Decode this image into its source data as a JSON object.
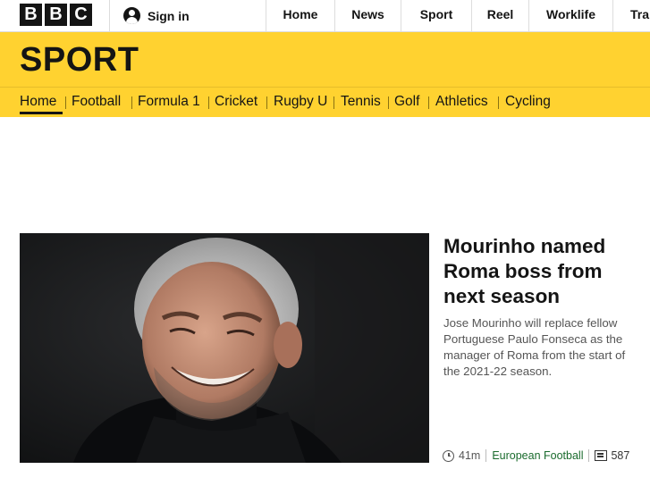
{
  "brand": {
    "letters": [
      "B",
      "B",
      "C"
    ]
  },
  "account": {
    "signin_label": "Sign in"
  },
  "topnav": [
    {
      "label": "Home"
    },
    {
      "label": "News"
    },
    {
      "label": "Sport"
    },
    {
      "label": "Reel"
    },
    {
      "label": "Worklife"
    },
    {
      "label": "Tra"
    }
  ],
  "section": {
    "title": "SPORT"
  },
  "subnav": [
    {
      "label": "Home",
      "active": true
    },
    {
      "label": "Football"
    },
    {
      "label": "Formula 1"
    },
    {
      "label": "Cricket"
    },
    {
      "label": "Rugby U"
    },
    {
      "label": "Tennis"
    },
    {
      "label": "Golf"
    },
    {
      "label": "Athletics"
    },
    {
      "label": "Cycling"
    }
  ],
  "story": {
    "headline": "Mourinho named Roma boss from next season",
    "summary": "Jose Mourinho will replace fellow Portuguese Paulo Fonseca as the manager of Roma from the start of the 2021-22 season.",
    "time": "41m",
    "topic": "European Football",
    "comments": "587",
    "image_alt": "Jose Mourinho smiling"
  },
  "colors": {
    "sport_yellow": "#ffd230",
    "topic_green": "#1a6b2d"
  }
}
